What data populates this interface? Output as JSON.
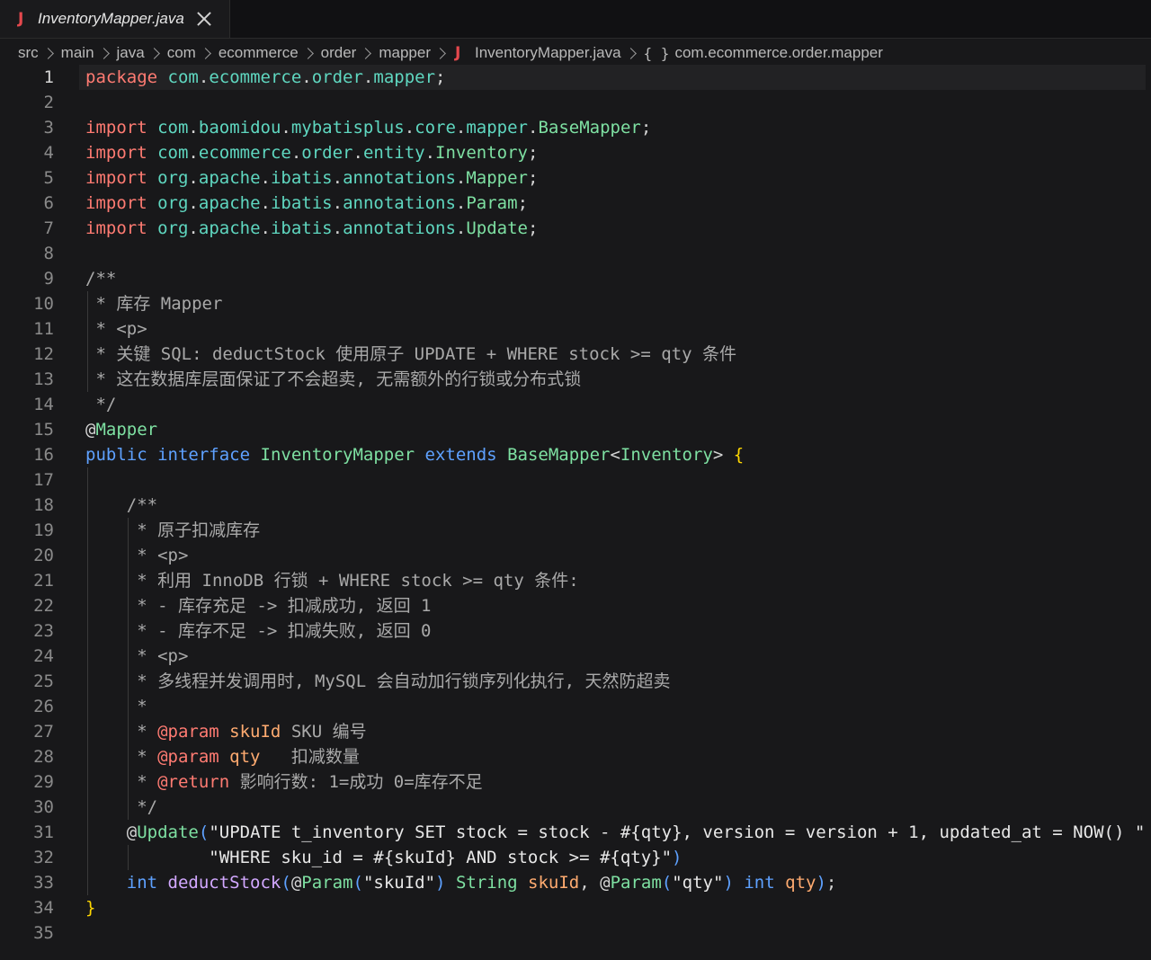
{
  "tab": {
    "file_icon": "J",
    "title": "InventoryMapper.java"
  },
  "breadcrumb": {
    "items": [
      "src",
      "main",
      "java",
      "com",
      "ecommerce",
      "order",
      "mapper"
    ],
    "file_icon": "J",
    "file": "InventoryMapper.java",
    "namespace_icon": "{ }",
    "namespace": "com.ecommerce.order.mapper"
  },
  "editor": {
    "active_line": 1,
    "lines": [
      [
        [
          "kw",
          "package"
        ],
        [
          "punc",
          " "
        ],
        [
          "pkg",
          "com"
        ],
        [
          "punc",
          "."
        ],
        [
          "pkg",
          "ecommerce"
        ],
        [
          "punc",
          "."
        ],
        [
          "pkg",
          "order"
        ],
        [
          "punc",
          "."
        ],
        [
          "pkg",
          "mapper"
        ],
        [
          "punc",
          ";"
        ]
      ],
      [],
      [
        [
          "kw",
          "import"
        ],
        [
          "punc",
          " "
        ],
        [
          "pkg",
          "com"
        ],
        [
          "punc",
          "."
        ],
        [
          "pkg",
          "baomidou"
        ],
        [
          "punc",
          "."
        ],
        [
          "pkg",
          "mybatisplus"
        ],
        [
          "punc",
          "."
        ],
        [
          "pkg",
          "core"
        ],
        [
          "punc",
          "."
        ],
        [
          "pkg",
          "mapper"
        ],
        [
          "punc",
          "."
        ],
        [
          "typ",
          "BaseMapper"
        ],
        [
          "punc",
          ";"
        ]
      ],
      [
        [
          "kw",
          "import"
        ],
        [
          "punc",
          " "
        ],
        [
          "pkg",
          "com"
        ],
        [
          "punc",
          "."
        ],
        [
          "pkg",
          "ecommerce"
        ],
        [
          "punc",
          "."
        ],
        [
          "pkg",
          "order"
        ],
        [
          "punc",
          "."
        ],
        [
          "pkg",
          "entity"
        ],
        [
          "punc",
          "."
        ],
        [
          "typ",
          "Inventory"
        ],
        [
          "punc",
          ";"
        ]
      ],
      [
        [
          "kw",
          "import"
        ],
        [
          "punc",
          " "
        ],
        [
          "pkg",
          "org"
        ],
        [
          "punc",
          "."
        ],
        [
          "pkg",
          "apache"
        ],
        [
          "punc",
          "."
        ],
        [
          "pkg",
          "ibatis"
        ],
        [
          "punc",
          "."
        ],
        [
          "pkg",
          "annotations"
        ],
        [
          "punc",
          "."
        ],
        [
          "typ",
          "Mapper"
        ],
        [
          "punc",
          ";"
        ]
      ],
      [
        [
          "kw",
          "import"
        ],
        [
          "punc",
          " "
        ],
        [
          "pkg",
          "org"
        ],
        [
          "punc",
          "."
        ],
        [
          "pkg",
          "apache"
        ],
        [
          "punc",
          "."
        ],
        [
          "pkg",
          "ibatis"
        ],
        [
          "punc",
          "."
        ],
        [
          "pkg",
          "annotations"
        ],
        [
          "punc",
          "."
        ],
        [
          "typ",
          "Param"
        ],
        [
          "punc",
          ";"
        ]
      ],
      [
        [
          "kw",
          "import"
        ],
        [
          "punc",
          " "
        ],
        [
          "pkg",
          "org"
        ],
        [
          "punc",
          "."
        ],
        [
          "pkg",
          "apache"
        ],
        [
          "punc",
          "."
        ],
        [
          "pkg",
          "ibatis"
        ],
        [
          "punc",
          "."
        ],
        [
          "pkg",
          "annotations"
        ],
        [
          "punc",
          "."
        ],
        [
          "typ",
          "Update"
        ],
        [
          "punc",
          ";"
        ]
      ],
      [],
      [
        [
          "cmt",
          "/**"
        ]
      ],
      [
        [
          "cmt",
          " * 库存 Mapper"
        ]
      ],
      [
        [
          "cmt",
          " * <p>"
        ]
      ],
      [
        [
          "cmt",
          " * 关键 SQL: deductStock 使用原子 UPDATE + WHERE stock >= qty 条件"
        ]
      ],
      [
        [
          "cmt",
          " * 这在数据库层面保证了不会超卖, 无需额外的行锁或分布式锁"
        ]
      ],
      [
        [
          "cmt",
          " */"
        ]
      ],
      [
        [
          "at",
          "@"
        ],
        [
          "ann",
          "Mapper"
        ]
      ],
      [
        [
          "kw2",
          "public"
        ],
        [
          "punc",
          " "
        ],
        [
          "kw2",
          "interface"
        ],
        [
          "punc",
          " "
        ],
        [
          "typ",
          "InventoryMapper"
        ],
        [
          "punc",
          " "
        ],
        [
          "kw2",
          "extends"
        ],
        [
          "punc",
          " "
        ],
        [
          "typ",
          "BaseMapper"
        ],
        [
          "punc",
          "<"
        ],
        [
          "typ",
          "Inventory"
        ],
        [
          "punc",
          "> "
        ],
        [
          "brace",
          "{"
        ]
      ],
      [],
      [
        [
          "cmt",
          "    /**"
        ]
      ],
      [
        [
          "cmt",
          "     * 原子扣减库存"
        ]
      ],
      [
        [
          "cmt",
          "     * <p>"
        ]
      ],
      [
        [
          "cmt",
          "     * 利用 InnoDB 行锁 + WHERE stock >= qty 条件:"
        ]
      ],
      [
        [
          "cmt",
          "     * - 库存充足 -> 扣减成功, 返回 1"
        ]
      ],
      [
        [
          "cmt",
          "     * - 库存不足 -> 扣减失败, 返回 0"
        ]
      ],
      [
        [
          "cmt",
          "     * <p>"
        ]
      ],
      [
        [
          "cmt",
          "     * 多线程并发调用时, MySQL 会自动加行锁序列化执行, 天然防超卖"
        ]
      ],
      [
        [
          "cmt",
          "     *"
        ]
      ],
      [
        [
          "cmt",
          "     * "
        ],
        [
          "javadoc-tag",
          "@param"
        ],
        [
          "cmt",
          " "
        ],
        [
          "prm",
          "skuId"
        ],
        [
          "cmt",
          " SKU 编号"
        ]
      ],
      [
        [
          "cmt",
          "     * "
        ],
        [
          "javadoc-tag",
          "@param"
        ],
        [
          "cmt",
          " "
        ],
        [
          "prm",
          "qty"
        ],
        [
          "cmt",
          "   扣减数量"
        ]
      ],
      [
        [
          "cmt",
          "     * "
        ],
        [
          "javadoc-tag",
          "@return"
        ],
        [
          "cmt",
          " 影响行数: 1=成功 0=库存不足"
        ]
      ],
      [
        [
          "cmt",
          "     */"
        ]
      ],
      [
        [
          "punc",
          "    "
        ],
        [
          "at",
          "@"
        ],
        [
          "ann",
          "Update"
        ],
        [
          "paren",
          "("
        ],
        [
          "str",
          "\"UPDATE t_inventory SET stock = stock - #{qty}, version = version + 1, updated_at = NOW() \" +"
        ]
      ],
      [
        [
          "punc",
          "            "
        ],
        [
          "str",
          "\"WHERE sku_id = #{skuId} AND stock >= #{qty}\""
        ],
        [
          "paren",
          ")"
        ]
      ],
      [
        [
          "punc",
          "    "
        ],
        [
          "kw2",
          "int"
        ],
        [
          "punc",
          " "
        ],
        [
          "fn",
          "deductStock"
        ],
        [
          "paren",
          "("
        ],
        [
          "at",
          "@"
        ],
        [
          "ann",
          "Param"
        ],
        [
          "paren",
          "("
        ],
        [
          "str",
          "\"skuId\""
        ],
        [
          "paren",
          ")"
        ],
        [
          "punc",
          " "
        ],
        [
          "typ",
          "String"
        ],
        [
          "punc",
          " "
        ],
        [
          "prm",
          "skuId"
        ],
        [
          "punc",
          ", "
        ],
        [
          "at",
          "@"
        ],
        [
          "ann",
          "Param"
        ],
        [
          "paren",
          "("
        ],
        [
          "str",
          "\"qty\""
        ],
        [
          "paren",
          ")"
        ],
        [
          "punc",
          " "
        ],
        [
          "kw2",
          "int"
        ],
        [
          "punc",
          " "
        ],
        [
          "prm",
          "qty"
        ],
        [
          "paren",
          ")"
        ],
        [
          "punc",
          ";"
        ]
      ],
      [
        [
          "brace",
          "}"
        ]
      ],
      []
    ]
  }
}
